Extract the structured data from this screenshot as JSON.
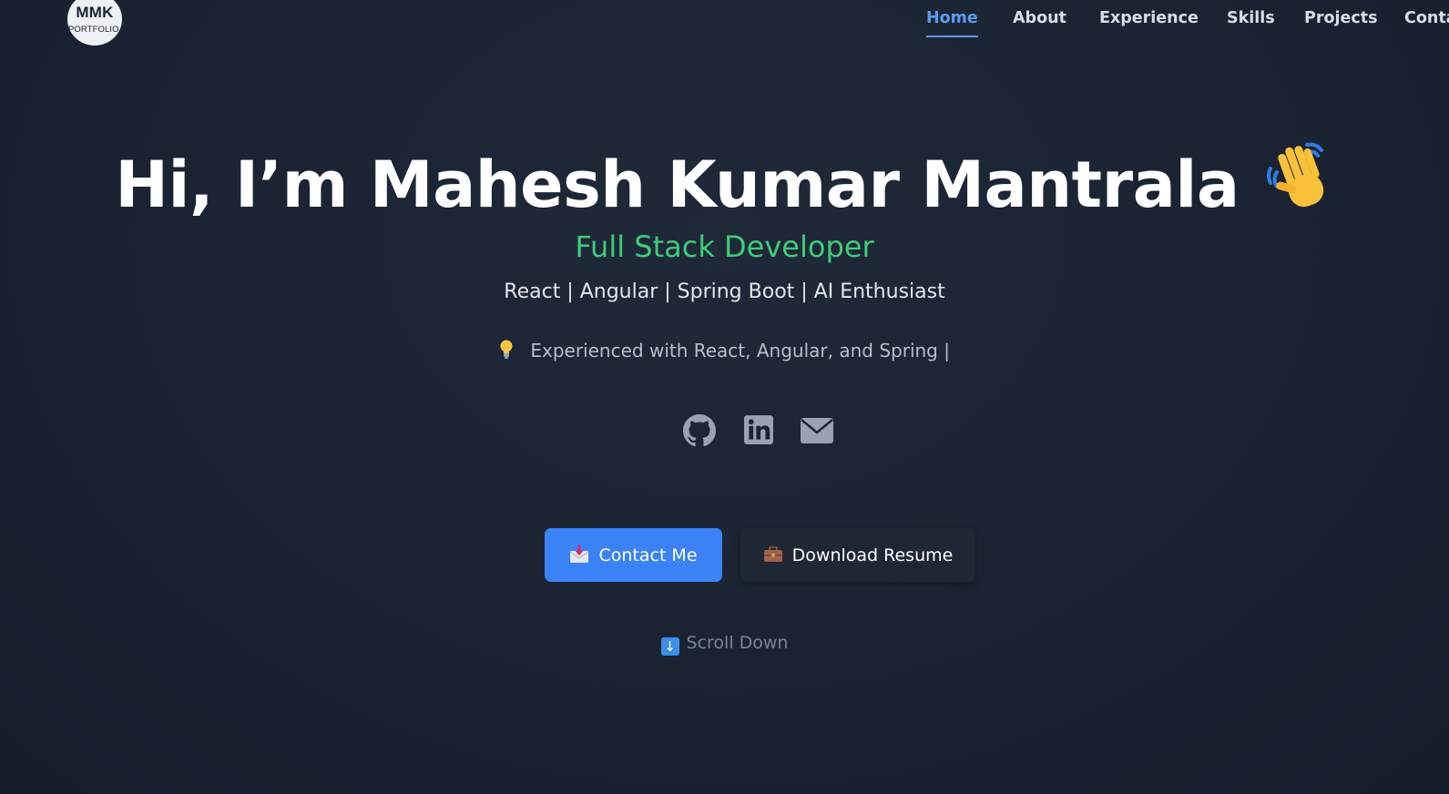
{
  "header": {
    "logo": {
      "line1": "MMK",
      "line2": "PORTFOLIO"
    },
    "nav": [
      {
        "label": "Home",
        "active": true
      },
      {
        "label": "About",
        "active": false
      },
      {
        "label": "Experience",
        "active": false
      },
      {
        "label": "Skills",
        "active": false
      },
      {
        "label": "Projects",
        "active": false
      },
      {
        "label": "Conta",
        "active": false
      }
    ]
  },
  "hero": {
    "title": "Hi, I’m Mahesh Kumar Mantrala",
    "title_emoji": "waving-hand",
    "role": "Full Stack Developer",
    "stack": "React | Angular | Spring Boot | AI Enthusiast",
    "typing_text": "Experienced with React, Angular, and Spring |",
    "typing_icon": "lightbulb-icon"
  },
  "socials": [
    {
      "name": "github-icon"
    },
    {
      "name": "linkedin-icon"
    },
    {
      "name": "email-icon"
    }
  ],
  "buttons": {
    "contact": {
      "label": "Contact Me",
      "icon": "envelope-arrow-icon"
    },
    "resume": {
      "label": "Download Resume",
      "icon": "briefcase-icon"
    }
  },
  "scroll_hint": {
    "label": "Scroll Down",
    "icon": "down-arrow-icon"
  },
  "colors": {
    "background": "#1b2333",
    "accent": "#3b82f6",
    "nav_active": "#5b9cf0",
    "role": "#3fcc7a",
    "text": "#ffffff"
  }
}
